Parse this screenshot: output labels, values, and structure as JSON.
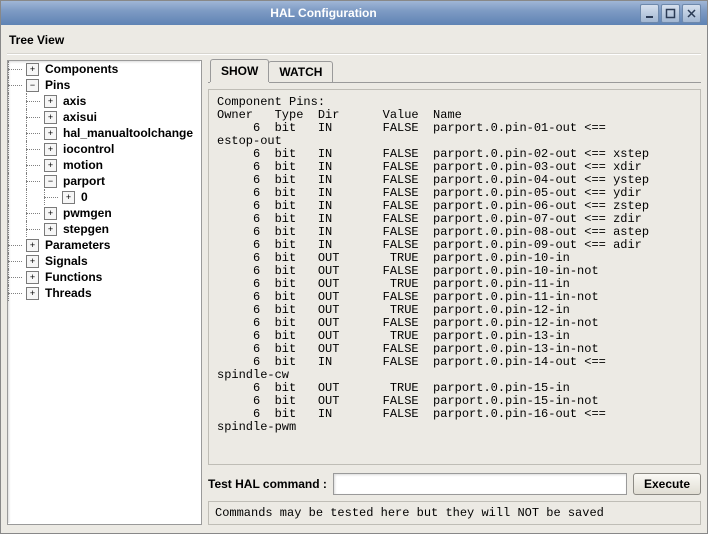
{
  "window": {
    "title": "HAL Configuration"
  },
  "tree_view_label": "Tree View",
  "tree": [
    {
      "label": "Components",
      "depth": 0,
      "expander": "+",
      "has_parent_cont": false
    },
    {
      "label": "Pins",
      "depth": 0,
      "expander": "−",
      "has_parent_cont": false
    },
    {
      "label": "axis",
      "depth": 1,
      "expander": "+",
      "has_parent_cont": true
    },
    {
      "label": "axisui",
      "depth": 1,
      "expander": "+",
      "has_parent_cont": true
    },
    {
      "label": "hal_manualtoolchange",
      "depth": 1,
      "expander": "+",
      "has_parent_cont": true
    },
    {
      "label": "iocontrol",
      "depth": 1,
      "expander": "+",
      "has_parent_cont": true
    },
    {
      "label": "motion",
      "depth": 1,
      "expander": "+",
      "has_parent_cont": true
    },
    {
      "label": "parport",
      "depth": 1,
      "expander": "−",
      "has_parent_cont": true
    },
    {
      "label": "0",
      "depth": 2,
      "expander": "+",
      "has_parent_cont": true,
      "grand_cont": true
    },
    {
      "label": "pwmgen",
      "depth": 1,
      "expander": "+",
      "has_parent_cont": true
    },
    {
      "label": "stepgen",
      "depth": 1,
      "expander": "+",
      "has_parent_cont": true
    },
    {
      "label": "Parameters",
      "depth": 0,
      "expander": "+",
      "has_parent_cont": false
    },
    {
      "label": "Signals",
      "depth": 0,
      "expander": "+",
      "has_parent_cont": false
    },
    {
      "label": "Functions",
      "depth": 0,
      "expander": "+",
      "has_parent_cont": false
    },
    {
      "label": "Threads",
      "depth": 0,
      "expander": "+",
      "has_parent_cont": false
    }
  ],
  "tabs": {
    "active": "SHOW",
    "items": [
      "SHOW",
      "WATCH"
    ]
  },
  "output_header": "Component Pins:",
  "columns": [
    "Owner",
    "Type",
    "Dir",
    "",
    "Value",
    "Name"
  ],
  "rows": [
    {
      "owner": "6",
      "type": "bit",
      "dir": "IN",
      "value": "FALSE",
      "name": "parport.0.pin-01-out <== estop-out",
      "wrap": "estop-out"
    },
    {
      "owner": "6",
      "type": "bit",
      "dir": "IN",
      "value": "FALSE",
      "name": "parport.0.pin-02-out <== xstep"
    },
    {
      "owner": "6",
      "type": "bit",
      "dir": "IN",
      "value": "FALSE",
      "name": "parport.0.pin-03-out <== xdir"
    },
    {
      "owner": "6",
      "type": "bit",
      "dir": "IN",
      "value": "FALSE",
      "name": "parport.0.pin-04-out <== ystep"
    },
    {
      "owner": "6",
      "type": "bit",
      "dir": "IN",
      "value": "FALSE",
      "name": "parport.0.pin-05-out <== ydir"
    },
    {
      "owner": "6",
      "type": "bit",
      "dir": "IN",
      "value": "FALSE",
      "name": "parport.0.pin-06-out <== zstep"
    },
    {
      "owner": "6",
      "type": "bit",
      "dir": "IN",
      "value": "FALSE",
      "name": "parport.0.pin-07-out <== zdir"
    },
    {
      "owner": "6",
      "type": "bit",
      "dir": "IN",
      "value": "FALSE",
      "name": "parport.0.pin-08-out <== astep"
    },
    {
      "owner": "6",
      "type": "bit",
      "dir": "IN",
      "value": "FALSE",
      "name": "parport.0.pin-09-out <== adir"
    },
    {
      "owner": "6",
      "type": "bit",
      "dir": "OUT",
      "value": "TRUE",
      "name": "parport.0.pin-10-in"
    },
    {
      "owner": "6",
      "type": "bit",
      "dir": "OUT",
      "value": "FALSE",
      "name": "parport.0.pin-10-in-not"
    },
    {
      "owner": "6",
      "type": "bit",
      "dir": "OUT",
      "value": "TRUE",
      "name": "parport.0.pin-11-in"
    },
    {
      "owner": "6",
      "type": "bit",
      "dir": "OUT",
      "value": "FALSE",
      "name": "parport.0.pin-11-in-not"
    },
    {
      "owner": "6",
      "type": "bit",
      "dir": "OUT",
      "value": "TRUE",
      "name": "parport.0.pin-12-in"
    },
    {
      "owner": "6",
      "type": "bit",
      "dir": "OUT",
      "value": "FALSE",
      "name": "parport.0.pin-12-in-not"
    },
    {
      "owner": "6",
      "type": "bit",
      "dir": "OUT",
      "value": "TRUE",
      "name": "parport.0.pin-13-in"
    },
    {
      "owner": "6",
      "type": "bit",
      "dir": "OUT",
      "value": "FALSE",
      "name": "parport.0.pin-13-in-not"
    },
    {
      "owner": "6",
      "type": "bit",
      "dir": "IN",
      "value": "FALSE",
      "name": "parport.0.pin-14-out <== spindle-cw",
      "wrap": "spindle-cw"
    },
    {
      "owner": "6",
      "type": "bit",
      "dir": "OUT",
      "value": "TRUE",
      "name": "parport.0.pin-15-in"
    },
    {
      "owner": "6",
      "type": "bit",
      "dir": "OUT",
      "value": "FALSE",
      "name": "parport.0.pin-15-in-not"
    },
    {
      "owner": "6",
      "type": "bit",
      "dir": "IN",
      "value": "FALSE",
      "name": "parport.0.pin-16-out <== spindle-pwm",
      "wrap": "spindle-pwm"
    }
  ],
  "cmd": {
    "label": "Test HAL command :",
    "value": "",
    "button": "Execute"
  },
  "status": "Commands may be tested here but they will NOT be saved"
}
